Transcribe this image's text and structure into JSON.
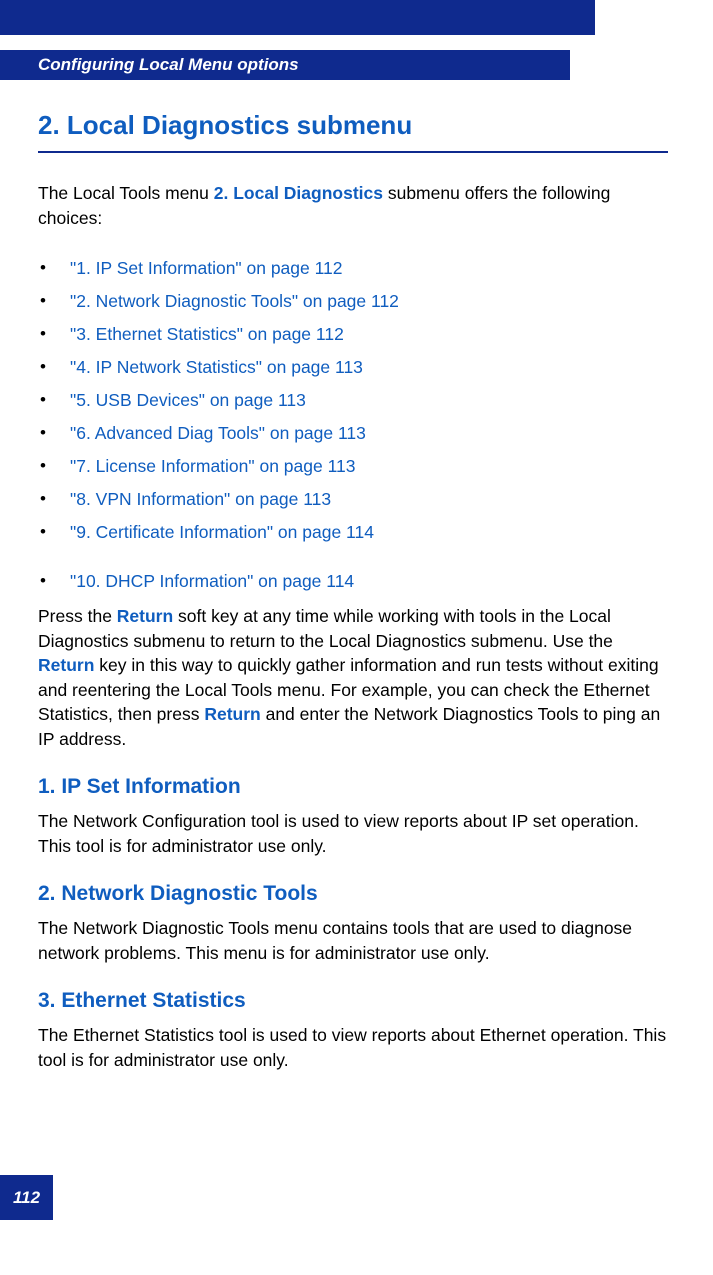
{
  "header": {
    "running_head": "Configuring Local Menu options"
  },
  "main": {
    "title": "2. Local Diagnostics submenu",
    "intro_prefix": "The Local Tools menu ",
    "intro_bold": "2. Local Diagnostics",
    "intro_suffix": " submenu offers the following choices:",
    "list": [
      "\"1. IP Set Information\" on page 112",
      "\"2. Network Diagnostic Tools\" on page 112",
      "\"3. Ethernet Statistics\" on page 112",
      "\"4. IP Network Statistics\" on page 113",
      "\"5. USB Devices\" on page 113",
      "\"6. Advanced Diag Tools\" on page 113",
      "\"7. License Information\" on page 113",
      "\"8. VPN Information\" on page 113",
      "\"9. Certificate Information\" on page 114"
    ],
    "list2": [
      "\"10. DHCP Information\" on page 114"
    ],
    "para1_a": "Press the ",
    "para1_b": "Return",
    "para1_c": " soft key at any time while working with tools in the Local Diagnostics submenu to return to the Local Diagnostics submenu. Use the ",
    "para1_d": "Return",
    "para1_e": " key in this way to quickly gather information and run tests without exiting and reentering the Local Tools menu. For example, you can check the Ethernet Statistics, then press ",
    "para1_f": "Return",
    "para1_g": " and enter the Network Diagnostics Tools to ping an IP address.",
    "sections": [
      {
        "heading": "1. IP Set Information",
        "body": "The Network Configuration tool is used to view reports about IP set operation. This tool is for administrator use only."
      },
      {
        "heading": "2. Network Diagnostic Tools",
        "body": "The Network Diagnostic Tools menu contains tools that are used to diagnose network problems. This menu is for administrator use only."
      },
      {
        "heading": "3. Ethernet Statistics",
        "body": "The Ethernet Statistics tool is used to view reports about Ethernet operation. This tool is for administrator use only."
      }
    ]
  },
  "footer": {
    "page_number": "112"
  }
}
